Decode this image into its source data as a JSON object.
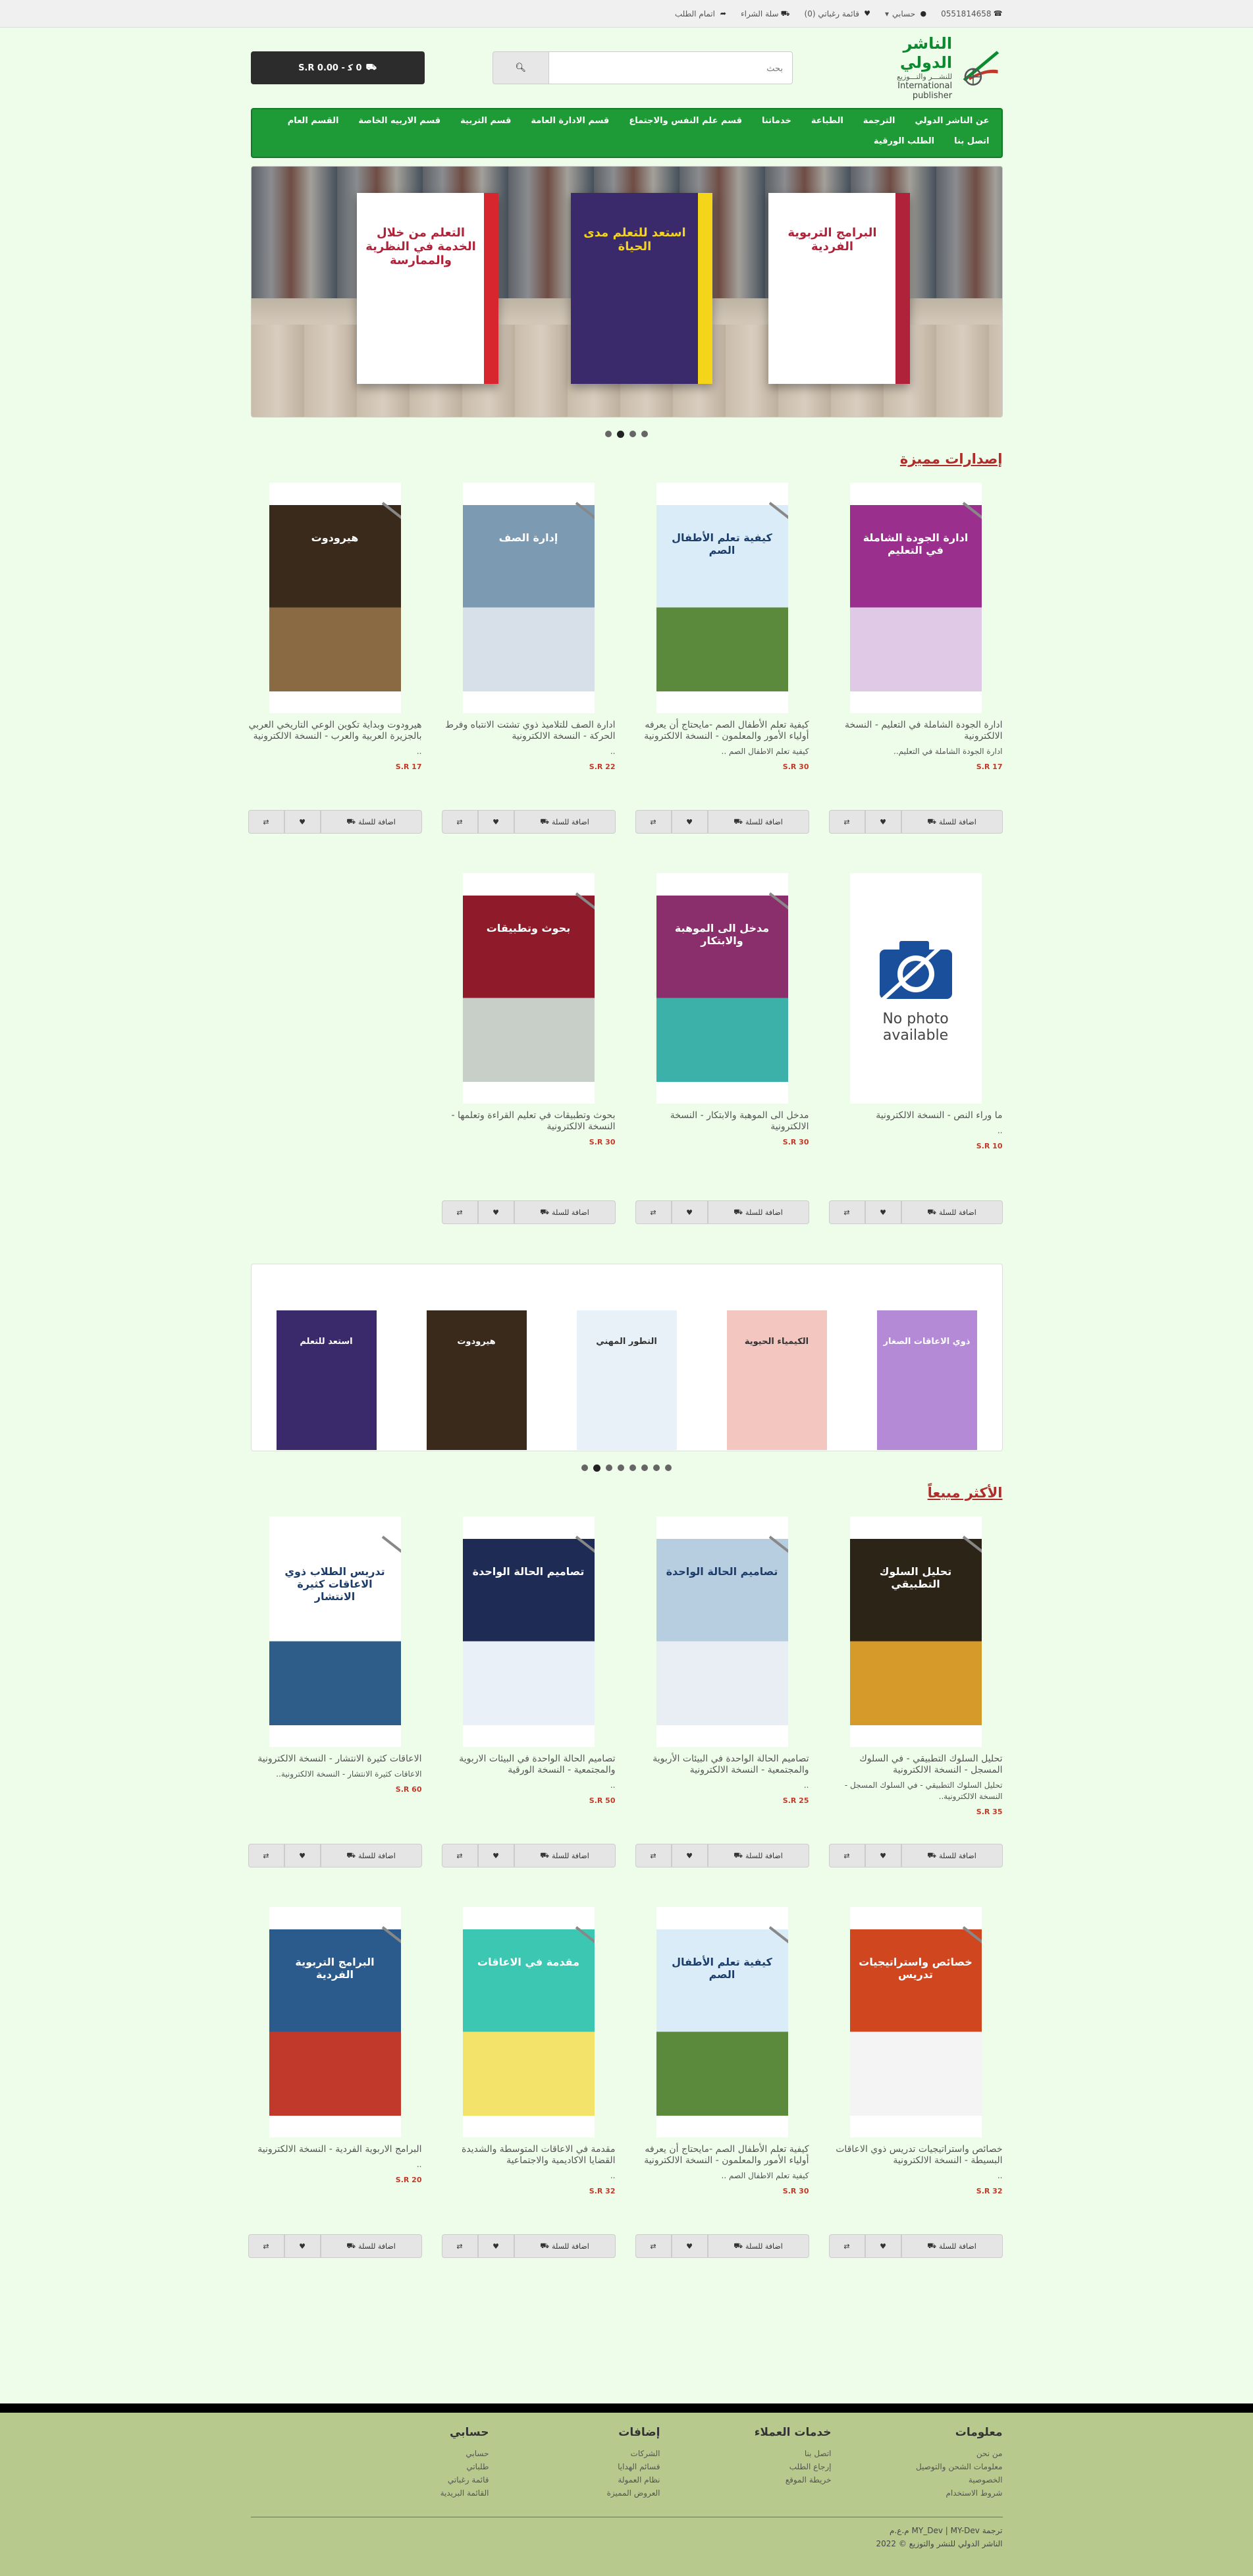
{
  "topbar": {
    "phone": "0551814658",
    "account": "حسابي",
    "wishlist": "قائمة رغباتي (0)",
    "cart": "سلة الشراء",
    "checkout": "اتمام الطلب"
  },
  "header": {
    "logo_ar": "الناشر الدولي",
    "logo_sub": "للنشـــر والتـــوزيع",
    "logo_en": "International publisher",
    "search_placeholder": "بحث",
    "cart_button": "0 ك‍ - 0.00 S.R"
  },
  "nav": [
    "عن الناشر الدولي",
    "الترجمة",
    "الطباعة",
    "خدماتنا",
    "قسم علم النفس والاجتماع",
    "قسم الادارة العامة",
    "قسم التربية",
    "قسم الاربيه الخاصة",
    "القسم العام",
    "اتصل بنا",
    "الطلب الورقية"
  ],
  "sections": {
    "featured": "إصدارات مميزة",
    "bestsellers": "الأكثر مبيعاً"
  },
  "actions": {
    "add": "اضافة للسلة"
  },
  "featured": [
    {
      "title": "ادارة الجودة الشاملة في التعليم - النسخة الالكترونية",
      "desc": "ادارة الجودة الشاملة في التعليم..",
      "price": "S.R 17",
      "bg": "#9b2f8e",
      "bg2": "#e0c9e6",
      "label": "ادارة الجودة الشاملة في التعليم"
    },
    {
      "title": "كيفية تعلم الأطفال الصم -مايحتاج أن يعرفه أولياء الأمور والمعلمون - النسخة الالكترونية",
      "desc": "كيفية تعلم الاطفال الصم ..",
      "price": "S.R 30",
      "bg": "#d9ecf7",
      "bg2": "#5b8a3c",
      "label": "كيفية تعلم الأطفال الصم"
    },
    {
      "title": "ادارة الصف للتلاميذ ذوي تشتت الانتباه وفرط الحركة - النسخة الالكترونية",
      "desc": "..",
      "price": "S.R 22",
      "bg": "#7c9bb3",
      "bg2": "#d7e0e8",
      "label": "إدارة الصف"
    },
    {
      "title": "هيرودوت وبداية تكوين الوعي التاريخي العربي بالجزيرة العربية والعرب - النسخة الالكترونية",
      "desc": "..",
      "price": "S.R 17",
      "bg": "#3a2a1c",
      "bg2": "#8a6a42",
      "label": "هيرودوت"
    },
    {
      "title": "ما وراء النص - النسخة الالكترونية",
      "desc": "..",
      "price": "S.R 10",
      "bg": "#ffffff",
      "bg2": "#ffffff",
      "label": "No photo available"
    },
    {
      "title": "مدخل الى الموهبة والابتكار - النسخة الالكترونية",
      "desc": "",
      "price": "S.R 30",
      "bg": "#8a2f6b",
      "bg2": "#3bb1a9",
      "label": "مدخل الى الموهبة والابتكار"
    },
    {
      "title": "بحوث وتطبيقات في تعليم القراءة وتعلمها - النسخة الالكترونية",
      "desc": "",
      "price": "S.R 30",
      "bg": "#8f1b2a",
      "bg2": "#c8cfc8",
      "label": "بحوث وتطبيقات"
    }
  ],
  "bestsellers": [
    {
      "title": "تحليل السلوك التطبيقي - في السلوك المسجل - النسخة الالكترونية",
      "desc": "تحليل السلوك التطبيقي - في السلوك المسجل - النسخة الالكترونية..",
      "price": "S.R 35",
      "bg": "#2d2418",
      "bg2": "#d69a2a",
      "label": "تحليل السلوك التطبيقي"
    },
    {
      "title": "تصاميم الحالة الواحدة في البيئات الأربوية والمجتمعية - النسخة الالكترونية",
      "desc": "..",
      "price": "S.R 25",
      "bg": "#b7cde0",
      "bg2": "#e8eef3",
      "label": "تصاميم الحالة الواحدة"
    },
    {
      "title": "تصاميم الحالة الواحدة في البيئات الاربوية والمجتمعية - النسخة الورقية",
      "desc": "..",
      "price": "S.R 50",
      "bg": "#1d2b55",
      "bg2": "#eaf0f7",
      "label": "تصاميم الحالة الواحدة"
    },
    {
      "title": "الاعاقات كثيرة الانتشار - النسخة الالكترونية",
      "desc": "الاعاقات كثيرة الانتشار - النسخة الالكترونية..",
      "price": "S.R 60",
      "bg": "#ffffff",
      "bg2": "#2f5d8a",
      "label": "تدريس الطلاب ذوي الاعاقات كثيرة الانتشار"
    },
    {
      "title": "خصائص واستراتيجيات تدريس ذوي الاعاقات البسيطة - النسخة الالكترونية",
      "desc": "..",
      "price": "S.R 32",
      "bg": "#d0461f",
      "bg2": "#f4f4f4",
      "label": "خصائص واستراتيجيات تدريس"
    },
    {
      "title": "كيفية تعلم الأطفال الصم -مايحتاج أن يعرفه أولياء الأمور والمعلمون - النسخة الالكترونية",
      "desc": "كيفية تعلم الاطفال الصم ..",
      "price": "S.R 30",
      "bg": "#d9ecf7",
      "bg2": "#5b8a3c",
      "label": "كيفية تعلم الأطفال الصم"
    },
    {
      "title": "مقدمة في الاعاقات المتوسطة والشديدة القضايا الاكاديمية والاجتماعية",
      "desc": "..",
      "price": "S.R 32",
      "bg": "#3cc7b3",
      "bg2": "#f3e36b",
      "label": "مقدمة في الاعاقات"
    },
    {
      "title": "البرامج الاربوية الفردية - النسخة الالكترونية",
      "desc": "..",
      "price": "S.R 20",
      "bg": "#2a5b8c",
      "bg2": "#c0392b",
      "label": "البرامج التربوية الفردية"
    }
  ],
  "slider": [
    {
      "label": "البرامج التربوية الفردية",
      "bg": "#ffffff",
      "accent": "#b0223a"
    },
    {
      "label": "استعد للتعلم مدى الحياة",
      "bg": "#3a2a6b",
      "accent": "#f5d51a"
    },
    {
      "label": "التعلم من خلال الخدمة في النظرية والممارسة",
      "bg": "#ffffff",
      "accent": "#d7262e"
    }
  ],
  "carousel": [
    {
      "label": "ذوي الاعاقات الصغار",
      "bg": "#b48ad6"
    },
    {
      "label": "الكيمياء الحيوية",
      "bg": "#f3c6c0"
    },
    {
      "label": "التطور المهني",
      "bg": "#e8f1f7"
    },
    {
      "label": "هيرودوت",
      "bg": "#3a2a1c"
    },
    {
      "label": "استعد للتعلم",
      "bg": "#3a2a6b"
    }
  ],
  "footer": {
    "cols": [
      {
        "h": "معلومات",
        "items": [
          "من نحن",
          "معلومات الشحن والتوصيل",
          "الخصوصية",
          "شروط الاستخدام"
        ]
      },
      {
        "h": "خدمات العملاء",
        "items": [
          "اتصل بنا",
          "إرجاع الطلب",
          "خريطة الموقع"
        ]
      },
      {
        "h": "إضافات",
        "items": [
          "الشركات",
          "قسائم الهدايا",
          "نظام العمولة",
          "العروض المميزة"
        ]
      },
      {
        "h": "حسابي",
        "items": [
          "حسابي",
          "طلباتي",
          "قائمة رغباتي",
          "القائمة البريدية"
        ]
      }
    ],
    "copy1": "ترجمة MY_Dev | MY-Dev م.ع.م",
    "copy2": "الناشر الدولي للنشر والتوزيع © 2022"
  },
  "colors": {
    "nav": "#1e9a37",
    "accent": "#b22b2b",
    "price": "#c0392b",
    "footer": "#b8c98e"
  }
}
